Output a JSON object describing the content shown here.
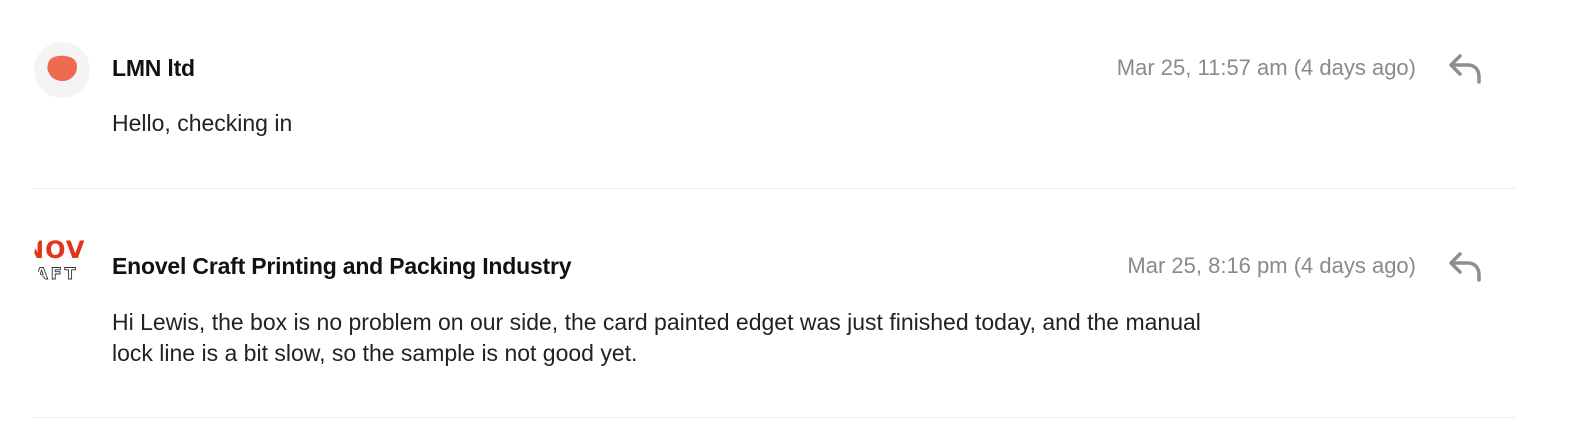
{
  "messages": [
    {
      "sender": "LMN ltd",
      "timestamp": "Mar 25, 11:57 am (4 days ago)",
      "body": "Hello, checking in",
      "avatar_icon": "orange-blob-logo",
      "avatar_color": "#ee6b4f"
    },
    {
      "sender": "Enovel Craft Printing and Packing Industry",
      "timestamp": "Mar 25, 8:16 pm (4 days ago)",
      "body": "Hi Lewis, the box is no problem on our side, the card painted edget was just finished today, and the manual lock line is a bit slow, so the sample is not good yet.",
      "avatar_icon": "enovel-craft-logo",
      "avatar_logo_text": "NOVEL CRAFT",
      "avatar_color": "#e2341d"
    }
  ],
  "reply_icon": "reply-arrow-icon",
  "colors": {
    "reply_icon": "#8e8e8e",
    "timestamp": "#8a8a8a",
    "divider": "#ececec"
  }
}
